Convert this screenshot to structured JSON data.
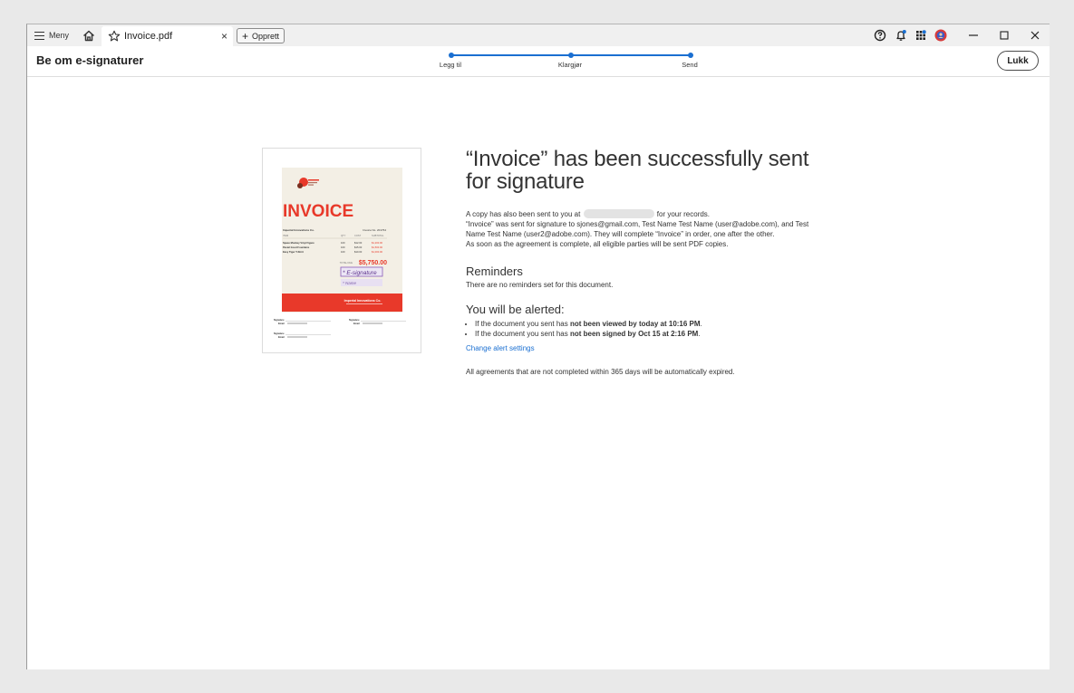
{
  "titlebar": {
    "menu_label": "Meny",
    "tab_title": "Invoice.pdf",
    "tab_close": "×",
    "create_label": "Opprett"
  },
  "header": {
    "title": "Be om e-signaturer",
    "steps": [
      "Legg til",
      "Klargjør",
      "Send"
    ],
    "close_label": "Lukk"
  },
  "thumbnail": {
    "company": "Imperial Innovations Co.",
    "invoice_title": "INVOICE",
    "invoice_no": "Invoice No. 201764",
    "columns": [
      "ITEM",
      "QTY",
      "COST",
      "SUBTOTAL"
    ],
    "rows": [
      [
        "Space Monkey Vinyl Figure",
        "100",
        "$12.00",
        "$1,200.00"
      ],
      [
        "Pastel Good Fountains",
        "100",
        "$15.00",
        "$1,500.00"
      ],
      [
        "Easy Tiger T-Shirt",
        "100",
        "$10.00",
        "$1,000.00"
      ]
    ],
    "total_label": "TOTAL DUE",
    "total": "$5,750.00",
    "esig_field": "* E-signature",
    "name_field": "* Name",
    "footer_company": "Imperial Innovations Co.",
    "sig_label": "Signature",
    "email_label": "Email"
  },
  "message": {
    "heading": "“Invoice” has been successfully sent for signature",
    "copy_pre": "A copy has also been sent to you at",
    "copy_post": "for your records.",
    "sent_line": "“Invoice” was sent for signature to sjones@gmail.com, Test Name Test Name (user@adobe.com), and Test Name Test Name (user2@adobe.com). They will complete “Invoice” in order, one after the other.",
    "complete_line": "As soon as the agreement is complete, all eligible parties will be sent PDF copies.",
    "reminders_title": "Reminders",
    "reminders_text": "There are no reminders set for this document.",
    "alerts_title": "You will be alerted:",
    "alert1_pre": "If the document you sent has ",
    "alert1_bold": "not been viewed by today at 10:16 PM",
    "alert2_pre": "If the document you sent has ",
    "alert2_bold": "not been signed by Oct 15 at 2:16 PM",
    "change_link": "Change alert settings",
    "expire_text": "All agreements that are not completed within 365 days will be automatically expired."
  },
  "colors": {
    "accent": "#1a6fd1",
    "invoice_red": "#e8392a",
    "paper": "#f3efe5"
  }
}
